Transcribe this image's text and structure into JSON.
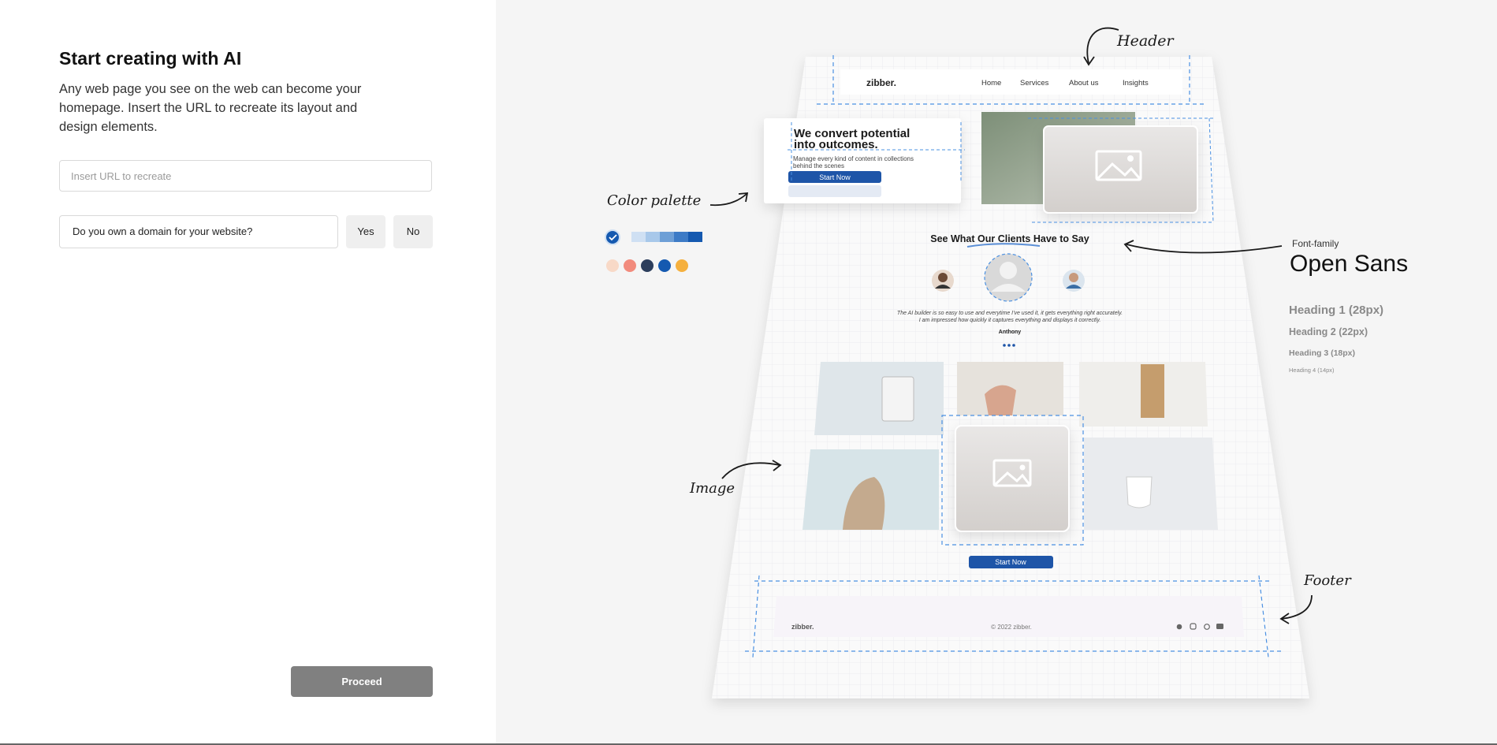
{
  "form": {
    "title": "Start creating with AI",
    "subtitle": "Any web page you see on the web can become your homepage. Insert the URL to recreate its layout and design elements.",
    "url_placeholder": "Insert URL to recreate",
    "url_value": "",
    "domain_question": "Do you own a domain for your website?",
    "yes_label": "Yes",
    "no_label": "No",
    "proceed_label": "Proceed"
  },
  "preview": {
    "annotations": {
      "header": "Header",
      "color_palette": "Color palette",
      "image": "Image",
      "footer": "Footer",
      "font_family_label": "Font-family",
      "font_family_name": "Open Sans",
      "heading1": "Heading 1 (28px)",
      "heading2": "Heading 2 (22px)",
      "heading3": "Heading 3 (18px)",
      "heading4": "Heading 4 (14px)"
    },
    "site": {
      "logo": "zibber.",
      "nav": [
        "Home",
        "Services",
        "About us",
        "Insights"
      ],
      "hero_title": "We convert potential into outcomes.",
      "hero_text": "Manage every kind of content in collections behind the scenes",
      "hero_button": "Start Now",
      "testimonials_title": "See What Our Clients Have to Say",
      "testimonial_text_1": "The AI builder is so easy to use and everytime I've used it, it gets everything right accurately.",
      "testimonial_text_2": "I am impressed how quickly it captures everything and displays it correctly.",
      "testimonial_author": "Anthony",
      "gallery_button": "Start Now",
      "footer_logo": "zibber.",
      "footer_copy": "© 2022 zibber."
    },
    "palette": {
      "blues": [
        "#cfe0f3",
        "#a8c8ea",
        "#6e9fd6",
        "#3d7bc6",
        "#1559b0"
      ],
      "swatches": [
        "#f8d9c7",
        "#f28b7d",
        "#2c3e5c",
        "#1559b0",
        "#f5b03e"
      ],
      "selected": "#1559b0"
    },
    "colors": {
      "accent": "#1e55a8",
      "dashed": "#4a90e2"
    }
  }
}
